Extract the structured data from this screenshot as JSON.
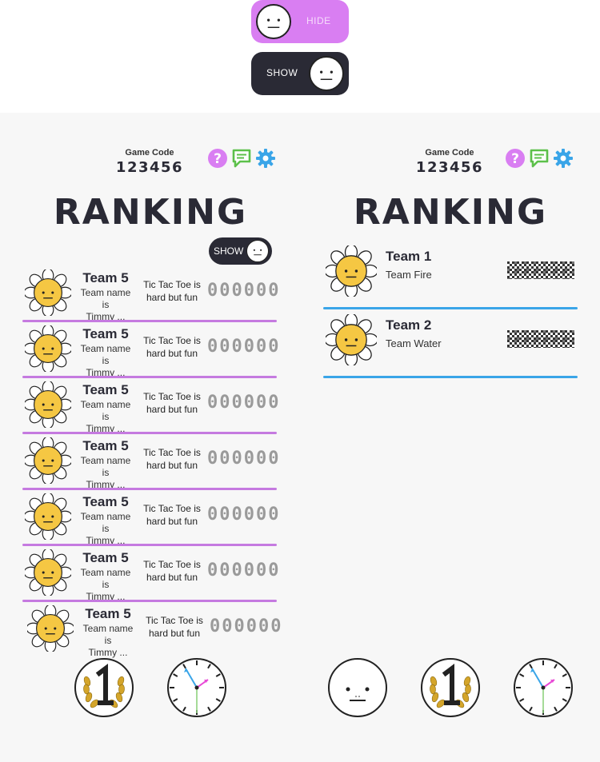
{
  "top_toggles": {
    "hide_label": "HIDE",
    "show_label": "SHOW"
  },
  "left_panel": {
    "game_code_label": "Game Code",
    "game_code": "123456",
    "title": "RANKING",
    "show_toggle_label": "SHOW",
    "rows": [
      {
        "name": "Team 5",
        "desc_line1": "Team name is",
        "desc_line2": "Timmy ...",
        "msg_line1": "Tic Tac Toe is",
        "msg_line2": "hard but fun",
        "score": "000000"
      },
      {
        "name": "Team 5",
        "desc_line1": "Team name is",
        "desc_line2": "Timmy ...",
        "msg_line1": "Tic Tac Toe is",
        "msg_line2": "hard but fun",
        "score": "000000"
      },
      {
        "name": "Team 5",
        "desc_line1": "Team name is",
        "desc_line2": "Timmy ...",
        "msg_line1": "Tic Tac Toe is",
        "msg_line2": "hard but fun",
        "score": "000000"
      },
      {
        "name": "Team 5",
        "desc_line1": "Team name is",
        "desc_line2": "Timmy ...",
        "msg_line1": "Tic Tac Toe is",
        "msg_line2": "hard but fun",
        "score": "000000"
      },
      {
        "name": "Team 5",
        "desc_line1": "Team name is",
        "desc_line2": "Timmy ...",
        "msg_line1": "Tic Tac Toe is",
        "msg_line2": "hard but fun",
        "score": "000000"
      },
      {
        "name": "Team 5",
        "desc_line1": "Team name is",
        "desc_line2": "Timmy ...",
        "msg_line1": "Tic Tac Toe is",
        "msg_line2": "hard but fun",
        "score": "000000"
      },
      {
        "name": "Team 5",
        "desc_line1": "Team name is",
        "desc_line2": "Timmy ...",
        "msg_line1": "Tic Tac Toe is",
        "msg_line2": "hard but fun",
        "score": "000000"
      }
    ],
    "bottom_icons": [
      "first-place-laurel-icon",
      "clock-icon"
    ]
  },
  "right_panel": {
    "game_code_label": "Game Code",
    "game_code": "123456",
    "title": "RANKING",
    "rows": [
      {
        "name": "Team 1",
        "sub": "Team Fire"
      },
      {
        "name": "Team 2",
        "sub": "Team Water"
      }
    ],
    "bottom_icons": [
      "neutral-face-icon",
      "first-place-laurel-icon",
      "clock-icon"
    ]
  },
  "header_icons": [
    "help-icon",
    "chat-icon",
    "settings-icon"
  ],
  "colors": {
    "purple": "#d97ef2",
    "dark": "#2a2a35",
    "blue": "#3aa5e8",
    "green": "#5cc04a",
    "separator_purple": "#c57ae0",
    "flower_yellow": "#f5c743",
    "laurel_gold": "#d4a52a"
  }
}
